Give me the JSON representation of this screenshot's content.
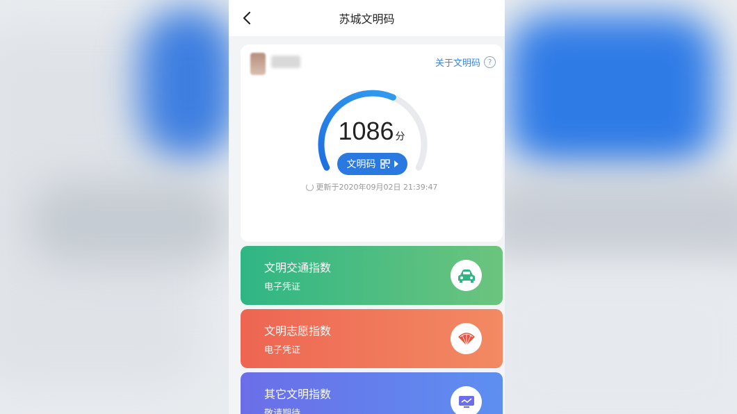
{
  "app": {
    "title": "苏城文明码"
  },
  "profile": {
    "about_label": "关于文明码",
    "help_glyph": "?"
  },
  "score": {
    "value": "1086",
    "unit": "分",
    "gauge_fill_fraction": 0.6
  },
  "code_button": {
    "label": "文明码"
  },
  "updated": {
    "text": "更新于2020年09月02日 21:39:47"
  },
  "indices": [
    {
      "title": "文明交通指数",
      "subtitle": "电子凭证",
      "icon": "car-icon",
      "color": "#2fb684"
    },
    {
      "title": "文明志愿指数",
      "subtitle": "电子凭证",
      "icon": "fan-icon",
      "color": "#ee6552"
    },
    {
      "title": "其它文明指数",
      "subtitle": "敬请期待",
      "icon": "monitor-icon",
      "color": "#6b6ee8"
    }
  ],
  "colors": {
    "accent": "#2a79e0",
    "link": "#3a86d8"
  }
}
